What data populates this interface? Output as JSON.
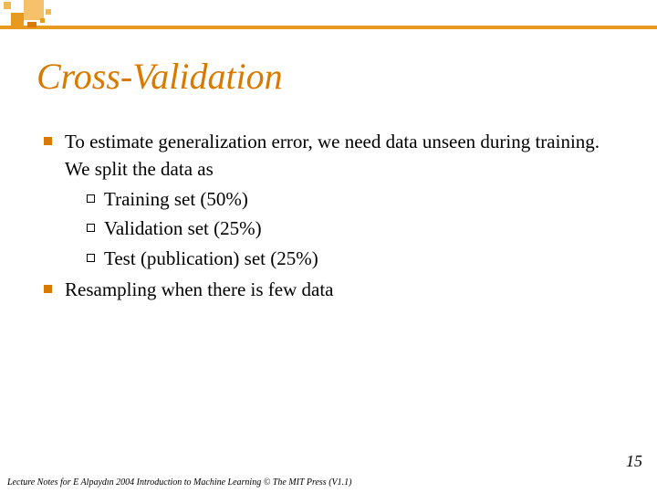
{
  "title": "Cross-Validation",
  "bullets": [
    {
      "text": "To estimate generalization error, we need data unseen during training. We split the data as",
      "sub": [
        "Training set (50%)",
        "Validation set (25%)",
        "Test (publication) set (25%)"
      ]
    },
    {
      "text": "Resampling when there is few data",
      "sub": []
    }
  ],
  "footer": "Lecture Notes for E Alpaydın 2004 Introduction to Machine Learning © The MIT Press (V1.1)",
  "page_number": "15",
  "colors": {
    "accent": "#d97a00",
    "accent_light": "#f7c06a"
  }
}
